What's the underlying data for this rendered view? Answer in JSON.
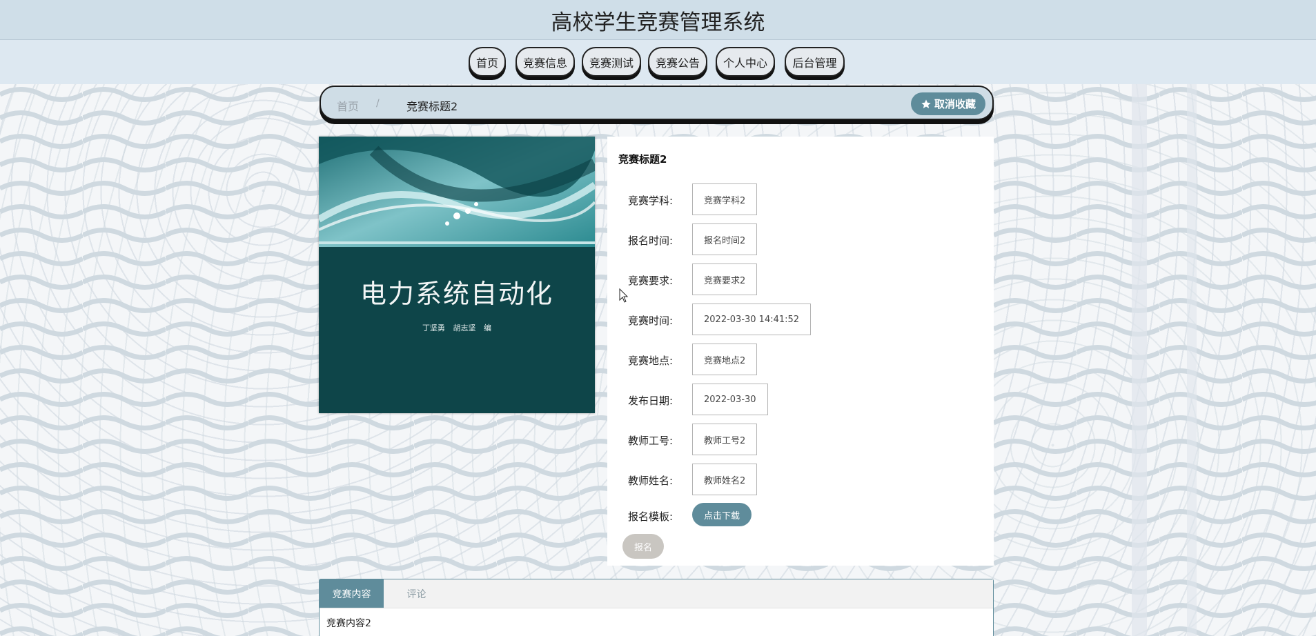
{
  "header": {
    "title": "高校学生竞赛管理系统"
  },
  "nav": {
    "items": [
      {
        "label": "首页"
      },
      {
        "label": "竞赛信息"
      },
      {
        "label": "竞赛测试"
      },
      {
        "label": "竞赛公告"
      },
      {
        "label": "个人中心"
      },
      {
        "label": "后台管理"
      }
    ]
  },
  "breadcrumb": {
    "home": "首页",
    "separator": "/",
    "current": "竞赛标题2",
    "favorite_label": "取消收藏"
  },
  "cover": {
    "title": "电力系统自动化",
    "authors": "丁坚勇 胡志坚 编"
  },
  "detail": {
    "title": "竞赛标题2",
    "fields": [
      {
        "label": "竞赛学科:",
        "value": "竞赛学科2"
      },
      {
        "label": "报名时间:",
        "value": "报名时间2"
      },
      {
        "label": "竞赛要求:",
        "value": "竞赛要求2"
      },
      {
        "label": "竞赛时间:",
        "value": "2022-03-30 14:41:52"
      },
      {
        "label": "竞赛地点:",
        "value": "竞赛地点2"
      },
      {
        "label": "发布日期:",
        "value": "2022-03-30"
      },
      {
        "label": "教师工号:",
        "value": "教师工号2"
      },
      {
        "label": "教师姓名:",
        "value": "教师姓名2"
      }
    ],
    "template_label": "报名模板:",
    "download_label": "点击下载",
    "signup_label": "报名"
  },
  "tabs": {
    "items": [
      {
        "label": "竞赛内容"
      },
      {
        "label": "评论"
      }
    ],
    "content": "竞赛内容2"
  },
  "colors": {
    "accent": "#5f8c9b",
    "header_bg": "#cfdee8",
    "nav_bg": "#dde8f1",
    "cover_bg": "#0e4549",
    "disabled_button": "#c9c6c1"
  }
}
